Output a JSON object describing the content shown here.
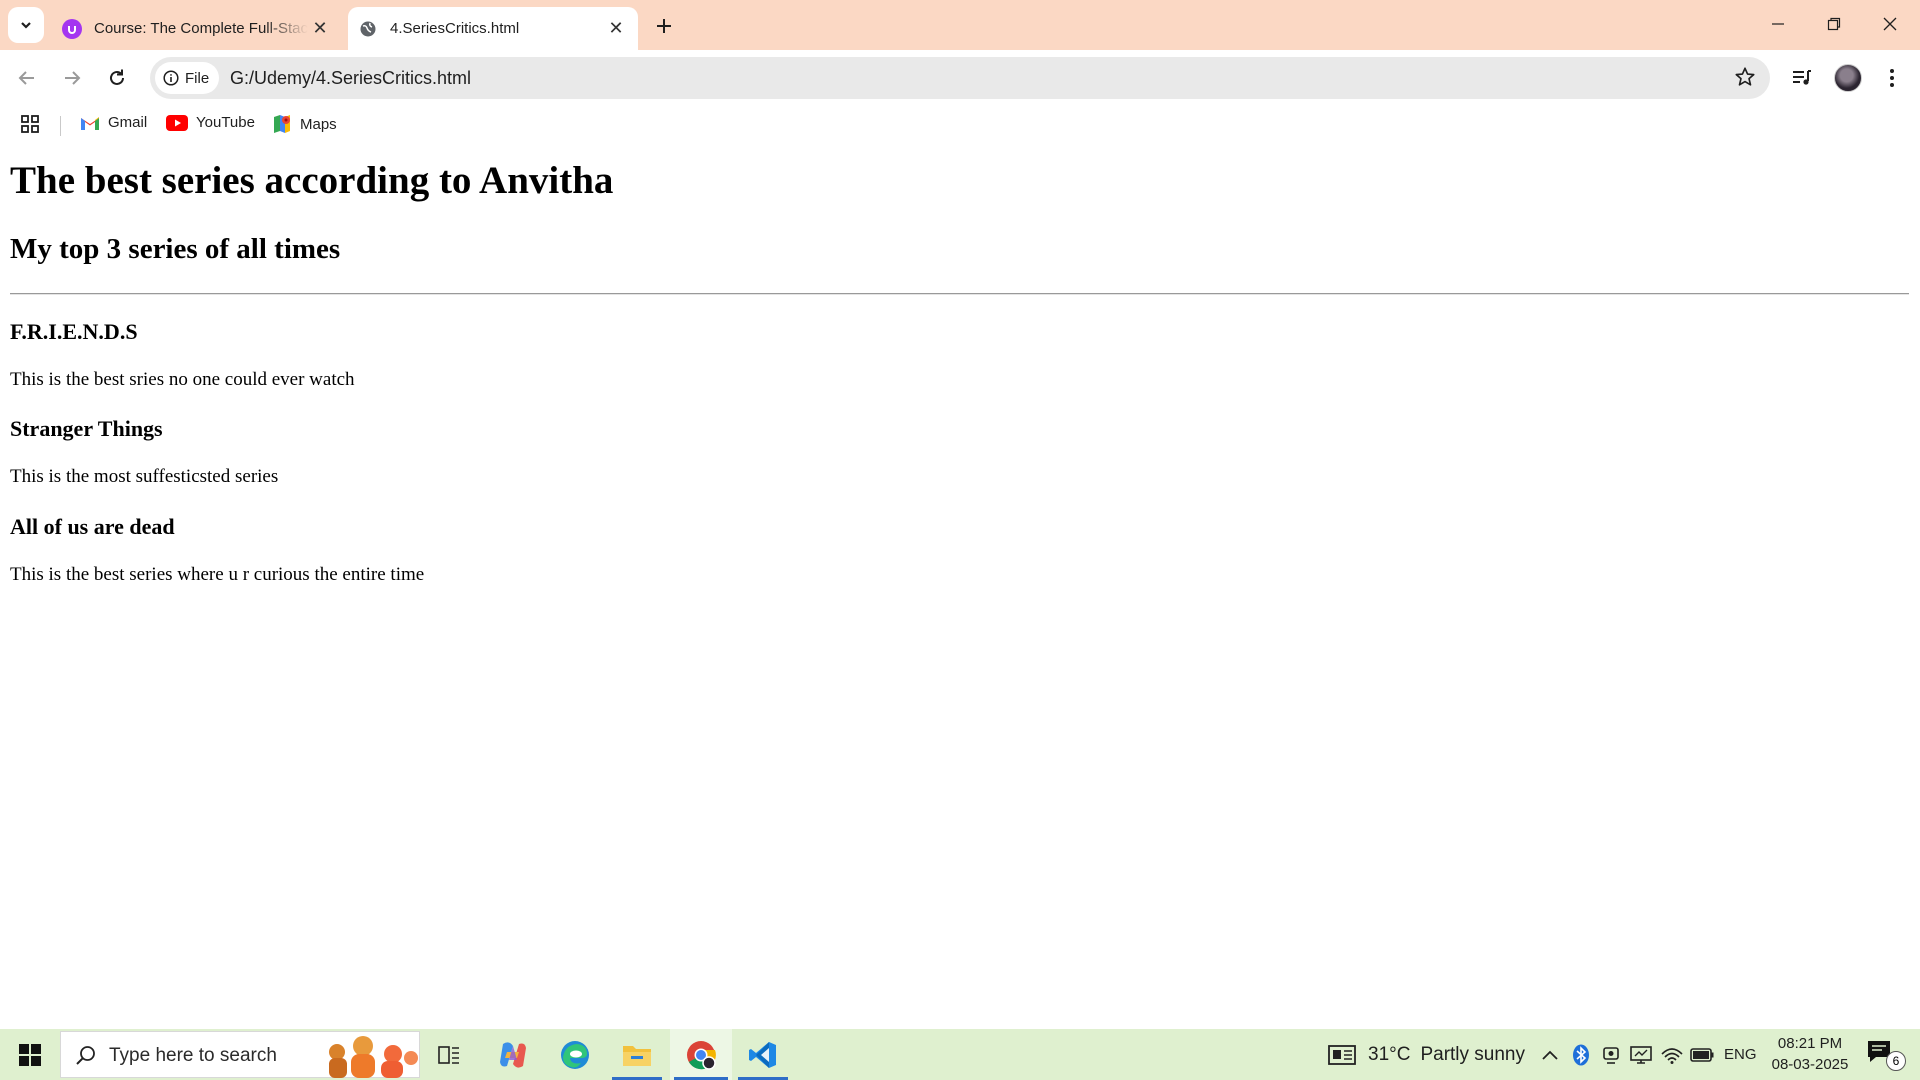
{
  "browser": {
    "tabs": [
      {
        "title": "Course: The Complete Full-Stack Web Development Bootcamp",
        "active": false,
        "icon": "udemy-icon"
      },
      {
        "title": "4.SeriesCritics.html",
        "active": true,
        "icon": "globe-icon"
      }
    ],
    "address": {
      "chip_label": "File",
      "url": "G:/Udemy/4.SeriesCritics.html"
    },
    "bookmarks": [
      {
        "label": "Gmail",
        "icon": "gmail-icon"
      },
      {
        "label": "YouTube",
        "icon": "youtube-icon"
      },
      {
        "label": "Maps",
        "icon": "maps-icon"
      }
    ],
    "tabstrip_color": "#fbd8c4"
  },
  "page": {
    "heading": "The best series according to Anvitha",
    "subheading": "My top 3 series of all times",
    "series": [
      {
        "title": "F.R.I.E.N.D.S",
        "description": "This is the best sries no one could ever watch"
      },
      {
        "title": "Stranger Things",
        "description": "This is the most suffesticsted series"
      },
      {
        "title": "All of us are dead",
        "description": "This is the best series where u r curious the entire time"
      }
    ]
  },
  "taskbar": {
    "search_placeholder": "Type here to search",
    "weather": {
      "temp": "31°C",
      "condition": "Partly sunny"
    },
    "language": "ENG",
    "time": "08:21 PM",
    "date": "08-03-2025",
    "notification_count": "6",
    "background": "#dff0cf"
  }
}
